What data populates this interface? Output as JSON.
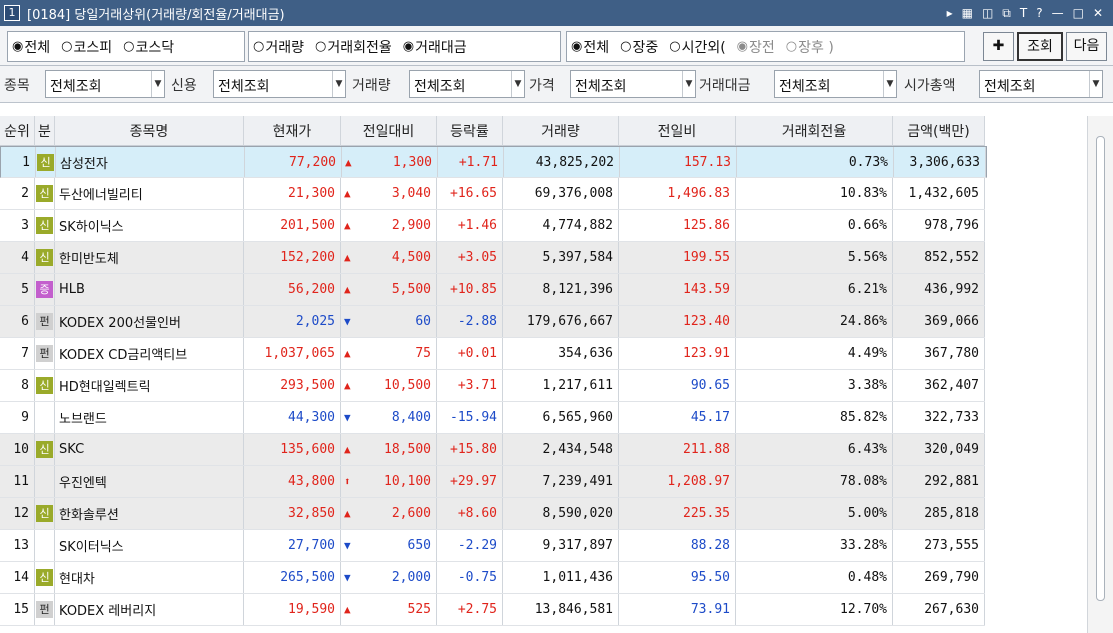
{
  "window": {
    "number": "1",
    "title": "[0184] 당일거래상위(거래량/회전율/거래대금)"
  },
  "market_filter": [
    {
      "label": "전체",
      "checked": true
    },
    {
      "label": "코스피",
      "checked": false
    },
    {
      "label": "코스닥",
      "checked": false
    }
  ],
  "sort_filter": [
    {
      "label": "거래량",
      "checked": false
    },
    {
      "label": "거래회전율",
      "checked": false
    },
    {
      "label": "거래대금",
      "checked": true
    }
  ],
  "session_filter": [
    {
      "label": "전체",
      "checked": true
    },
    {
      "label": "장중",
      "checked": false
    },
    {
      "label": "시간외(",
      "checked": false
    },
    {
      "label": "장전",
      "checked": true
    },
    {
      "label": "장후 )",
      "checked": false
    }
  ],
  "buttons": {
    "add_icon": "✚",
    "query": "조회",
    "next": "다음"
  },
  "filters": [
    {
      "label": "종목",
      "value": "전체조회"
    },
    {
      "label": "신용",
      "value": "전체조회"
    },
    {
      "label": "거래량",
      "value": "전체조회"
    },
    {
      "label": "가격",
      "value": "전체조회"
    },
    {
      "label": "거래대금",
      "value": "전체조회"
    },
    {
      "label": "시가총액",
      "value": "전체조회"
    }
  ],
  "columns": [
    "순위",
    "분",
    "종목명",
    "현재가",
    "전일대비",
    "등락률",
    "거래량",
    "전일비",
    "거래회전율",
    "금액(백만)"
  ],
  "rows": [
    {
      "rank": "1",
      "badge": "신",
      "name": "삼성전자",
      "price": "77,200",
      "arrow": "▲",
      "change": "1,300",
      "rate": "+1.71",
      "volume": "43,825,202",
      "prev_ratio": "157.13",
      "turnover": "0.73%",
      "amount": "3,306,633",
      "color": "red",
      "ratio_color": "red",
      "row": "sel"
    },
    {
      "rank": "2",
      "badge": "신",
      "name": "두산에너빌리티",
      "price": "21,300",
      "arrow": "▲",
      "change": "3,040",
      "rate": "+16.65",
      "volume": "69,376,008",
      "prev_ratio": "1,496.83",
      "turnover": "10.83%",
      "amount": "1,432,605",
      "color": "red",
      "ratio_color": "red",
      "row": "white"
    },
    {
      "rank": "3",
      "badge": "신",
      "name": "SK하이닉스",
      "price": "201,500",
      "arrow": "▲",
      "change": "2,900",
      "rate": "+1.46",
      "volume": "4,774,882",
      "prev_ratio": "125.86",
      "turnover": "0.66%",
      "amount": "978,796",
      "color": "red",
      "ratio_color": "red",
      "row": "white"
    },
    {
      "rank": "4",
      "badge": "신",
      "name": "한미반도체",
      "price": "152,200",
      "arrow": "▲",
      "change": "4,500",
      "rate": "+3.05",
      "volume": "5,397,584",
      "prev_ratio": "199.55",
      "turnover": "5.56%",
      "amount": "852,552",
      "color": "red",
      "ratio_color": "red",
      "row": "gray"
    },
    {
      "rank": "5",
      "badge": "증",
      "name": "HLB",
      "price": "56,200",
      "arrow": "▲",
      "change": "5,500",
      "rate": "+10.85",
      "volume": "8,121,396",
      "prev_ratio": "143.59",
      "turnover": "6.21%",
      "amount": "436,992",
      "color": "red",
      "ratio_color": "red",
      "row": "gray"
    },
    {
      "rank": "6",
      "badge": "펀",
      "name": "KODEX 200선물인버",
      "price": "2,025",
      "arrow": "▼",
      "change": "60",
      "rate": "-2.88",
      "volume": "179,676,667",
      "prev_ratio": "123.40",
      "turnover": "24.86%",
      "amount": "369,066",
      "color": "blue",
      "ratio_color": "red",
      "row": "gray"
    },
    {
      "rank": "7",
      "badge": "펀",
      "name": "KODEX CD금리액티브",
      "price": "1,037,065",
      "arrow": "▲",
      "change": "75",
      "rate": "+0.01",
      "volume": "354,636",
      "prev_ratio": "123.91",
      "turnover": "4.49%",
      "amount": "367,780",
      "color": "red",
      "ratio_color": "red",
      "row": "white"
    },
    {
      "rank": "8",
      "badge": "신",
      "name": "HD현대일렉트릭",
      "price": "293,500",
      "arrow": "▲",
      "change": "10,500",
      "rate": "+3.71",
      "volume": "1,217,611",
      "prev_ratio": "90.65",
      "turnover": "3.38%",
      "amount": "362,407",
      "color": "red",
      "ratio_color": "blue",
      "row": "white"
    },
    {
      "rank": "9",
      "badge": "",
      "name": "노브랜드",
      "price": "44,300",
      "arrow": "▼",
      "change": "8,400",
      "rate": "-15.94",
      "volume": "6,565,960",
      "prev_ratio": "45.17",
      "turnover": "85.82%",
      "amount": "322,733",
      "color": "blue",
      "ratio_color": "blue",
      "row": "white"
    },
    {
      "rank": "10",
      "badge": "신",
      "name": "SKC",
      "price": "135,600",
      "arrow": "▲",
      "change": "18,500",
      "rate": "+15.80",
      "volume": "2,434,548",
      "prev_ratio": "211.88",
      "turnover": "6.43%",
      "amount": "320,049",
      "color": "red",
      "ratio_color": "red",
      "row": "gray"
    },
    {
      "rank": "11",
      "badge": "",
      "name": "우진엔텍",
      "price": "43,800",
      "arrow": "⬆",
      "change": "10,100",
      "rate": "+29.97",
      "volume": "7,239,491",
      "prev_ratio": "1,208.97",
      "turnover": "78.08%",
      "amount": "292,881",
      "color": "red",
      "ratio_color": "red",
      "row": "gray"
    },
    {
      "rank": "12",
      "badge": "신",
      "name": "한화솔루션",
      "price": "32,850",
      "arrow": "▲",
      "change": "2,600",
      "rate": "+8.60",
      "volume": "8,590,020",
      "prev_ratio": "225.35",
      "turnover": "5.00%",
      "amount": "285,818",
      "color": "red",
      "ratio_color": "red",
      "row": "gray"
    },
    {
      "rank": "13",
      "badge": "",
      "name": "SK이터닉스",
      "price": "27,700",
      "arrow": "▼",
      "change": "650",
      "rate": "-2.29",
      "volume": "9,317,897",
      "prev_ratio": "88.28",
      "turnover": "33.28%",
      "amount": "273,555",
      "color": "blue",
      "ratio_color": "blue",
      "row": "white"
    },
    {
      "rank": "14",
      "badge": "신",
      "name": "현대차",
      "price": "265,500",
      "arrow": "▼",
      "change": "2,000",
      "rate": "-0.75",
      "volume": "1,011,436",
      "prev_ratio": "95.50",
      "turnover": "0.48%",
      "amount": "269,790",
      "color": "blue",
      "ratio_color": "blue",
      "row": "white"
    },
    {
      "rank": "15",
      "badge": "펀",
      "name": "KODEX 레버리지",
      "price": "19,590",
      "arrow": "▲",
      "change": "525",
      "rate": "+2.75",
      "volume": "13,846,581",
      "prev_ratio": "73.91",
      "turnover": "12.70%",
      "amount": "267,630",
      "color": "red",
      "ratio_color": "blue",
      "row": "white"
    }
  ],
  "badge_colors": {
    "신": "#9aaa2a",
    "증": "#c35fcd",
    "펀": "#d0d0d0"
  },
  "colors": {
    "title_bar": "#3f5f86",
    "up": "#e0241b",
    "down": "#1d4bc8",
    "selected_row": "#d6eef9",
    "gray_row": "#ebebeb"
  }
}
